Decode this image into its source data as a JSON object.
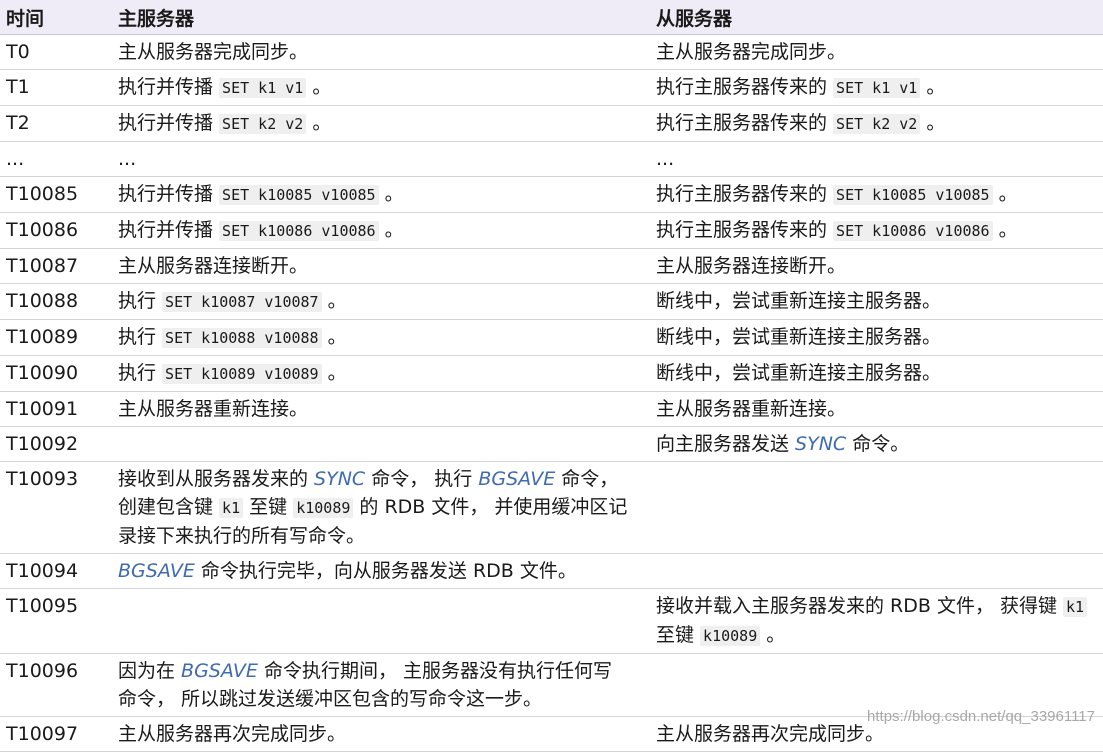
{
  "headers": [
    "时间",
    "主服务器",
    "从服务器"
  ],
  "rows": [
    {
      "time": "T0",
      "master": [
        {
          "t": "主从服务器完成同步。"
        }
      ],
      "slave": [
        {
          "t": "主从服务器完成同步。"
        }
      ]
    },
    {
      "time": "T1",
      "master": [
        {
          "t": "执行并传播 "
        },
        {
          "c": "SET k1 v1"
        },
        {
          "t": " 。"
        }
      ],
      "slave": [
        {
          "t": "执行主服务器传来的 "
        },
        {
          "c": "SET k1 v1"
        },
        {
          "t": " 。"
        }
      ]
    },
    {
      "time": "T2",
      "master": [
        {
          "t": "执行并传播 "
        },
        {
          "c": "SET k2 v2"
        },
        {
          "t": " 。"
        }
      ],
      "slave": [
        {
          "t": "执行主服务器传来的 "
        },
        {
          "c": "SET k2 v2"
        },
        {
          "t": " 。"
        }
      ]
    },
    {
      "time": "...",
      "master": [
        {
          "t": "..."
        }
      ],
      "slave": [
        {
          "t": "..."
        }
      ]
    },
    {
      "time": "T10085",
      "master": [
        {
          "t": "执行并传播 "
        },
        {
          "c": "SET k10085 v10085"
        },
        {
          "t": " 。"
        }
      ],
      "slave": [
        {
          "t": "执行主服务器传来的 "
        },
        {
          "c": "SET k10085 v10085"
        },
        {
          "t": " 。"
        }
      ]
    },
    {
      "time": "T10086",
      "master": [
        {
          "t": "执行并传播 "
        },
        {
          "c": "SET k10086 v10086"
        },
        {
          "t": " 。"
        }
      ],
      "slave": [
        {
          "t": "执行主服务器传来的 "
        },
        {
          "c": "SET k10086 v10086"
        },
        {
          "t": " 。"
        }
      ]
    },
    {
      "time": "T10087",
      "master": [
        {
          "t": "主从服务器连接断开。"
        }
      ],
      "slave": [
        {
          "t": "主从服务器连接断开。"
        }
      ]
    },
    {
      "time": "T10088",
      "master": [
        {
          "t": "执行 "
        },
        {
          "c": "SET k10087 v10087"
        },
        {
          "t": " 。"
        }
      ],
      "slave": [
        {
          "t": "断线中，尝试重新连接主服务器。"
        }
      ]
    },
    {
      "time": "T10089",
      "master": [
        {
          "t": "执行 "
        },
        {
          "c": "SET k10088 v10088"
        },
        {
          "t": " 。"
        }
      ],
      "slave": [
        {
          "t": "断线中，尝试重新连接主服务器。"
        }
      ]
    },
    {
      "time": "T10090",
      "master": [
        {
          "t": "执行 "
        },
        {
          "c": "SET k10089 v10089"
        },
        {
          "t": " 。"
        }
      ],
      "slave": [
        {
          "t": "断线中，尝试重新连接主服务器。"
        }
      ]
    },
    {
      "time": "T10091",
      "master": [
        {
          "t": "主从服务器重新连接。"
        }
      ],
      "slave": [
        {
          "t": "主从服务器重新连接。"
        }
      ]
    },
    {
      "time": "T10092",
      "master": [],
      "slave": [
        {
          "t": "向主服务器发送 "
        },
        {
          "e": "SYNC"
        },
        {
          "t": " 命令。"
        }
      ]
    },
    {
      "time": "T10093",
      "master": [
        {
          "t": "接收到从服务器发来的 "
        },
        {
          "e": "SYNC"
        },
        {
          "t": " 命令， 执行 "
        },
        {
          "e": "BGSAVE"
        },
        {
          "t": " 命令， 创建包含键 "
        },
        {
          "c": "k1"
        },
        {
          "t": " 至键 "
        },
        {
          "c": "k10089"
        },
        {
          "t": " 的 RDB 文件， 并使用缓冲区记录接下来执行的所有写命令。"
        }
      ],
      "slave": []
    },
    {
      "time": "T10094",
      "master": [
        {
          "e": "BGSAVE"
        },
        {
          "t": " 命令执行完毕，向从服务器发送 RDB 文件。"
        }
      ],
      "slave": []
    },
    {
      "time": "T10095",
      "master": [],
      "slave": [
        {
          "t": "接收并载入主服务器发来的 RDB 文件， 获得键 "
        },
        {
          "c": "k1"
        },
        {
          "t": " 至键 "
        },
        {
          "c": "k10089"
        },
        {
          "t": " 。"
        }
      ]
    },
    {
      "time": "T10096",
      "master": [
        {
          "t": "因为在 "
        },
        {
          "e": "BGSAVE"
        },
        {
          "t": " 命令执行期间， 主服务器没有执行任何写命令， 所以跳过发送缓冲区包含的写命令这一步。"
        }
      ],
      "slave": []
    },
    {
      "time": "T10097",
      "master": [
        {
          "t": "主从服务器再次完成同步。"
        }
      ],
      "slave": [
        {
          "t": "主从服务器再次完成同步。"
        }
      ]
    }
  ],
  "watermark": "https://blog.csdn.net/qq_33961117"
}
